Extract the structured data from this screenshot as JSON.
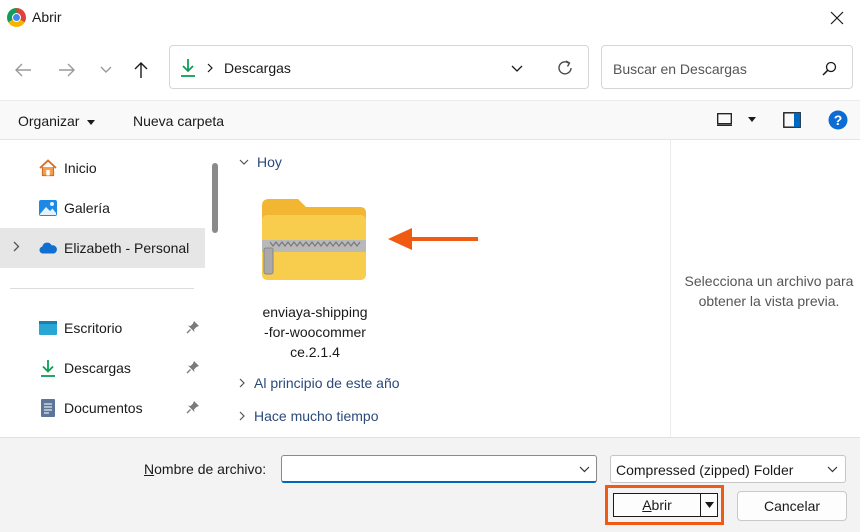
{
  "window": {
    "title": "Abrir"
  },
  "address": {
    "current_folder": "Descargas"
  },
  "search": {
    "placeholder": "Buscar en Descargas"
  },
  "commandbar": {
    "organize_label": "Organizar",
    "new_folder_label": "Nueva carpeta"
  },
  "sidebar": {
    "items": [
      {
        "label": "Inicio",
        "icon": "home-icon"
      },
      {
        "label": "Galería",
        "icon": "gallery-icon"
      },
      {
        "label": "Elizabeth - Personal",
        "icon": "onedrive-cloud-icon"
      },
      {
        "label": "Escritorio",
        "icon": "desktop-icon"
      },
      {
        "label": "Descargas",
        "icon": "download-icon"
      },
      {
        "label": "Documentos",
        "icon": "documents-icon"
      }
    ]
  },
  "main": {
    "groups": [
      {
        "label": "Hoy"
      },
      {
        "label": "Al principio de este año"
      },
      {
        "label": "Hace mucho tiempo"
      }
    ],
    "file": {
      "line1": "enviaya-shipping",
      "line2": "-for-woocommer",
      "line3": "ce.2.1.4"
    }
  },
  "preview": {
    "line1": "Selecciona un archivo para",
    "line2": "obtener la vista previa."
  },
  "bottom": {
    "filename_label_accel": "N",
    "filename_label_rest": "ombre de archivo:",
    "filename_value": "",
    "filetype": "Compressed (zipped) Folder",
    "open_accel": "A",
    "open_rest": "brir",
    "cancel_label": "Cancelar"
  },
  "colors": {
    "accent": "#0067c0",
    "highlight": "#f05a12",
    "folder": "#f8cd4e"
  }
}
